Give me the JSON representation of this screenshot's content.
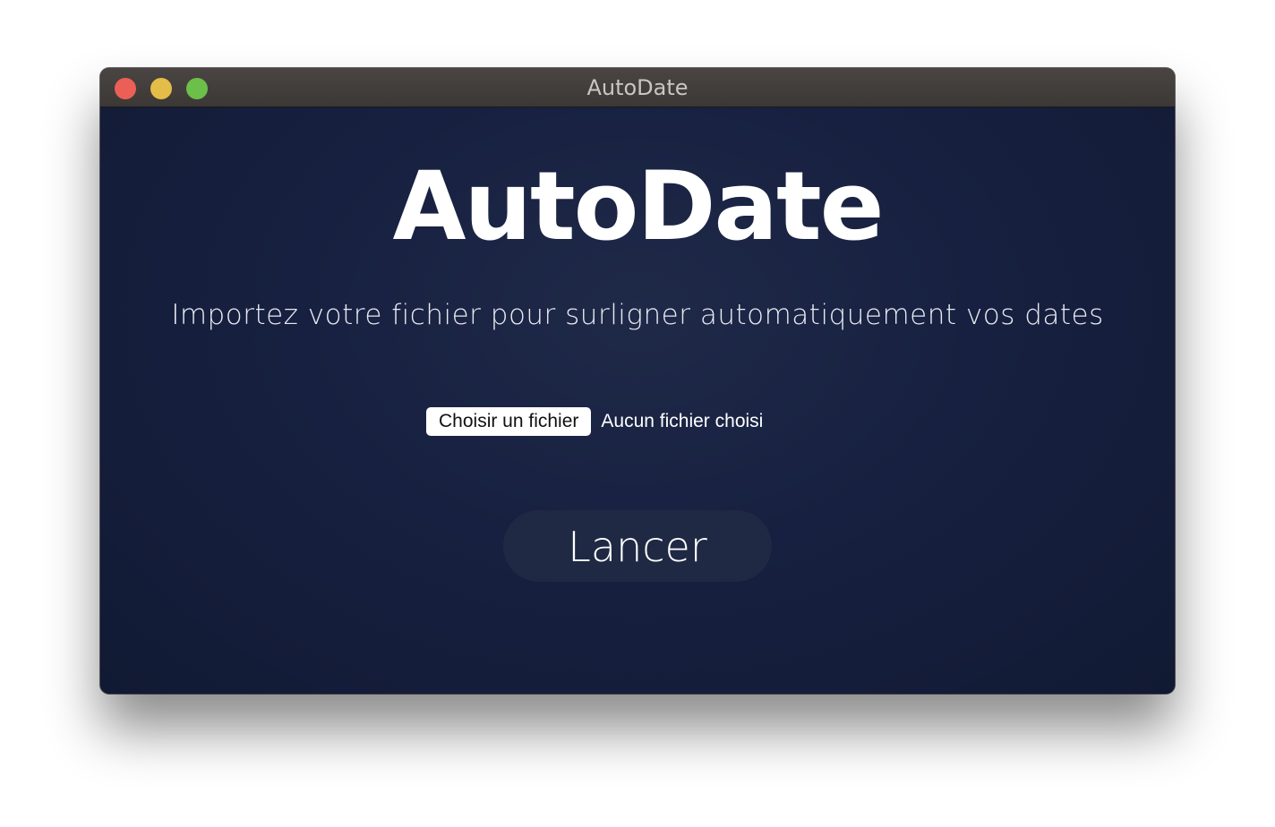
{
  "window": {
    "title": "AutoDate",
    "controls": {
      "close": "close-traffic-light",
      "minimize": "minimize-traffic-light",
      "maximize": "maximize-traffic-light"
    }
  },
  "main": {
    "heading": "AutoDate",
    "subtitle": "Importez votre fichier pour surligner automatiquement vos dates",
    "file_input": {
      "button_label": "Choisir un fichier",
      "status": "Aucun fichier choisi"
    },
    "launch_label": "Lancer"
  },
  "colors": {
    "background": "#141c35",
    "titlebar": "#423d3a",
    "launch_button": "#1f2944",
    "close": "#ec5f57",
    "minimize": "#e3bd47",
    "maximize": "#6cbf48"
  }
}
